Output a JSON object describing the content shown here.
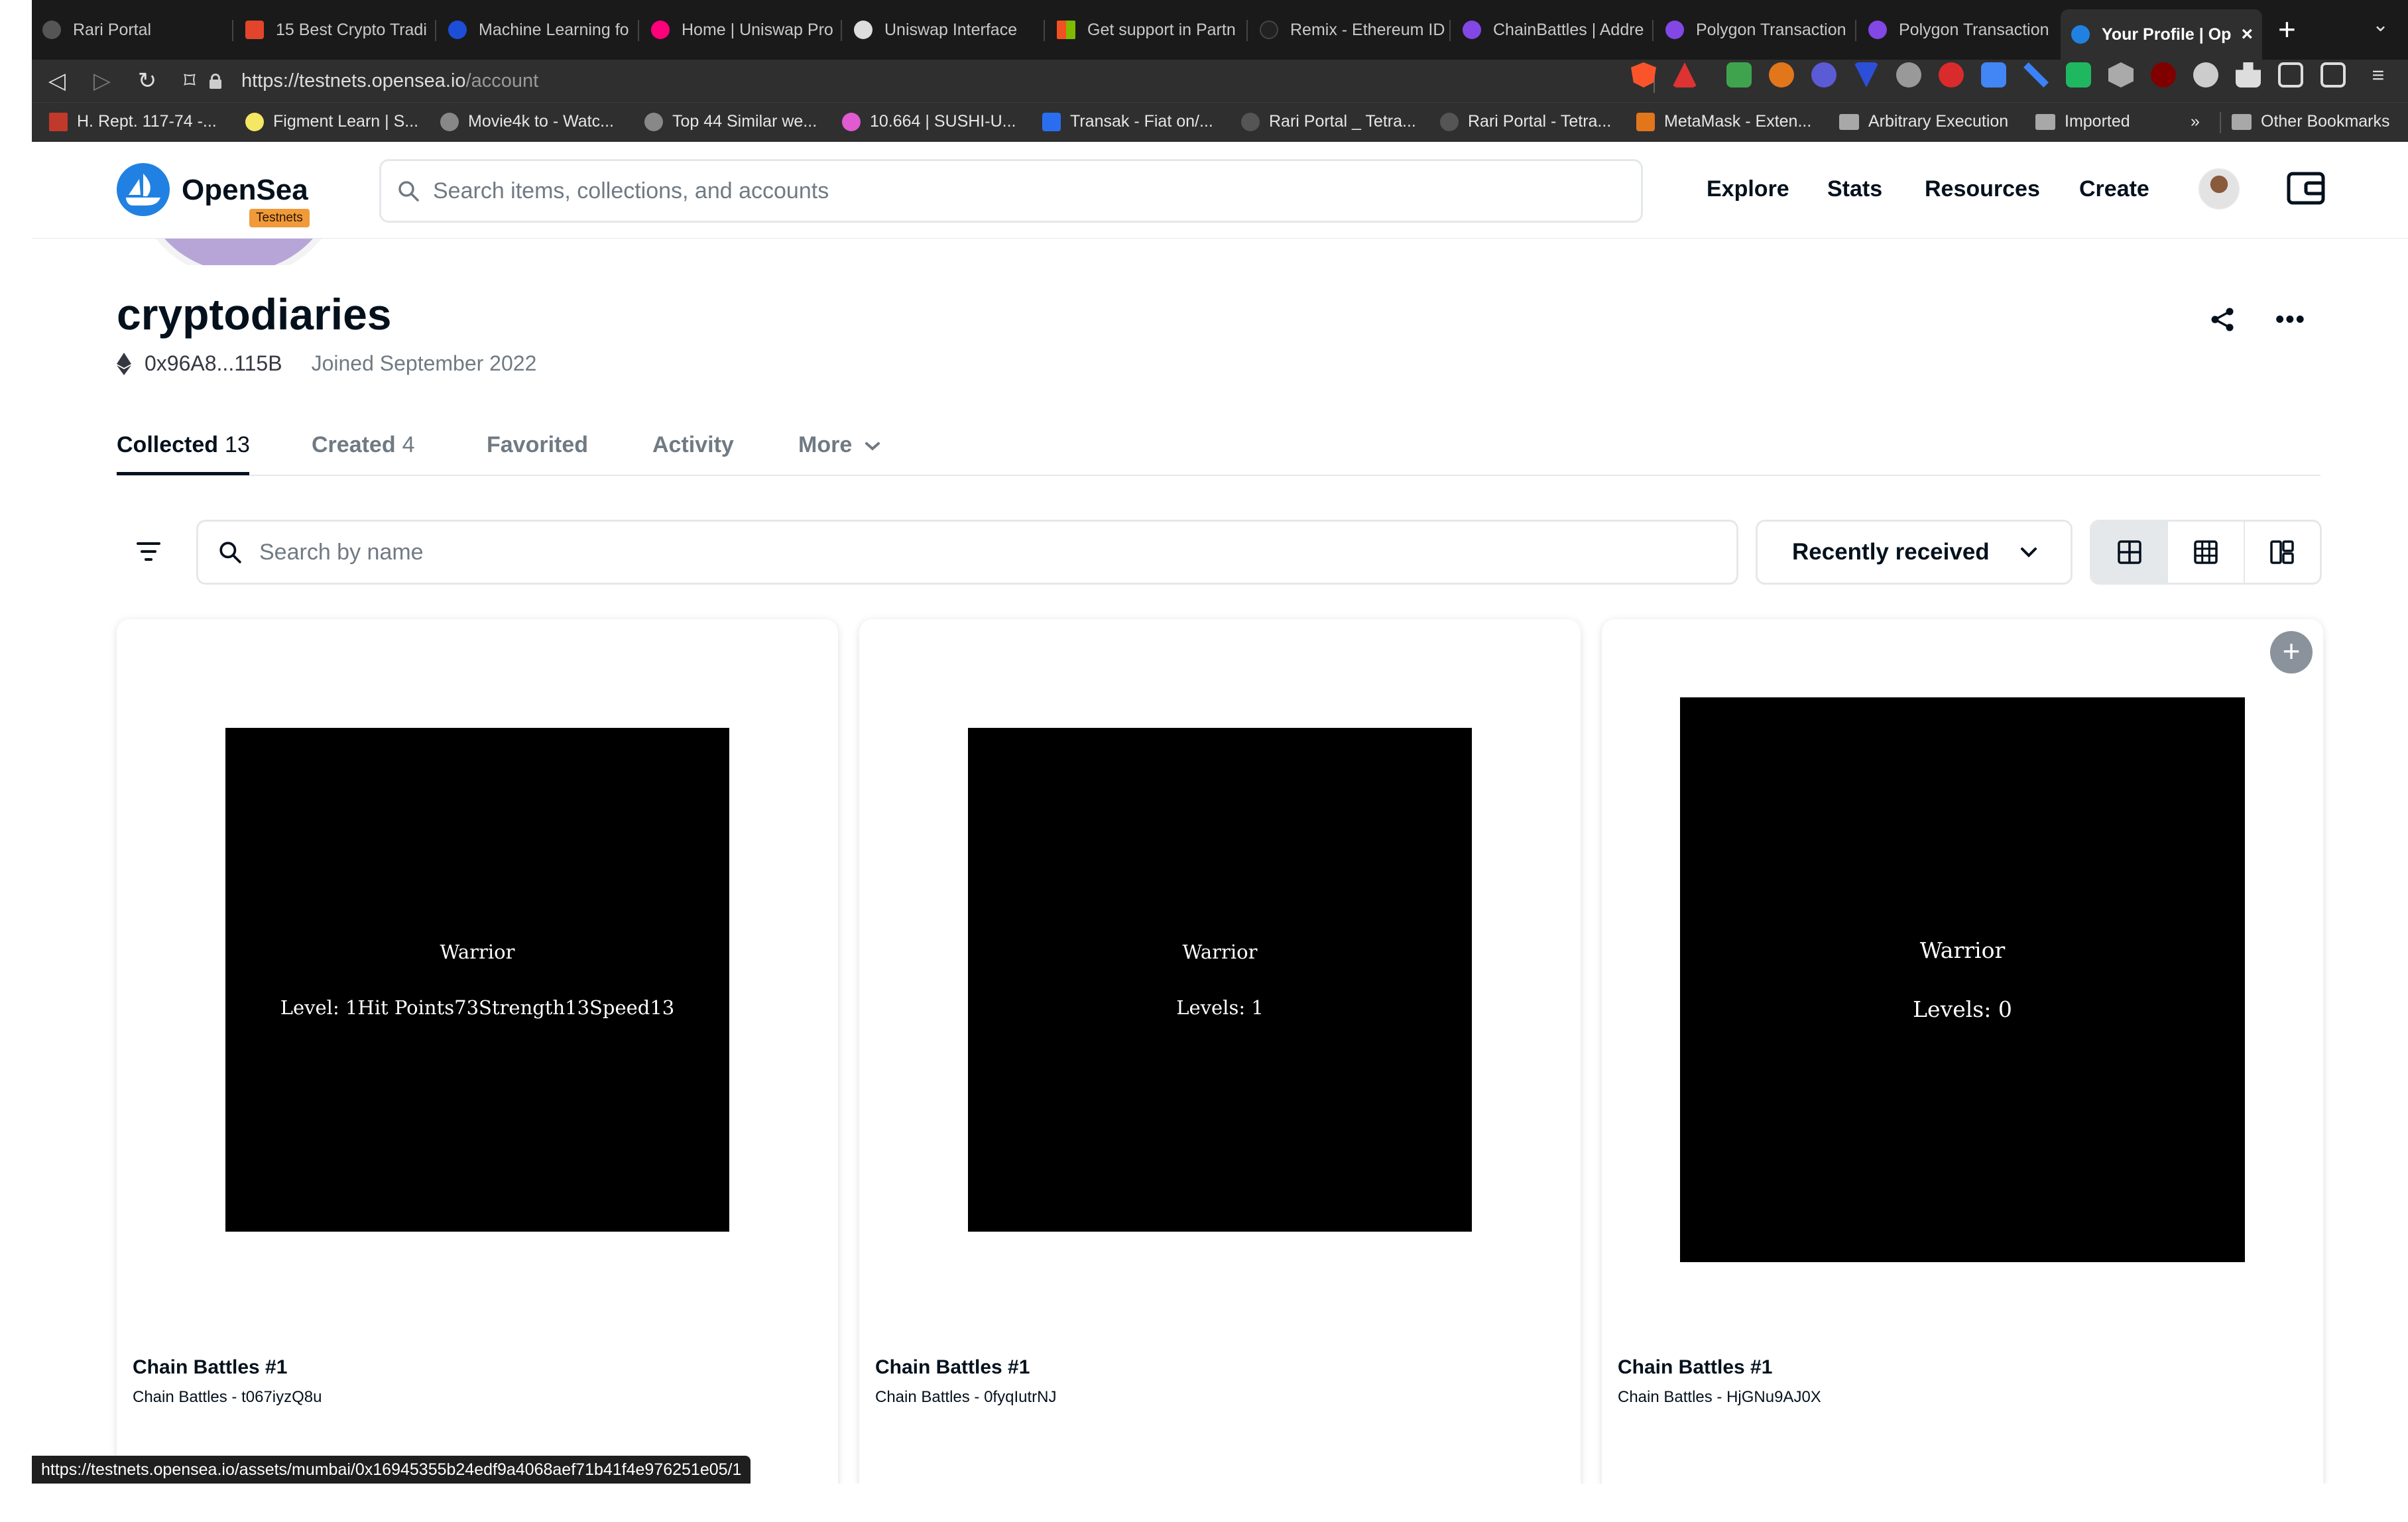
{
  "browser": {
    "tabs": [
      {
        "label": "Rari Portal",
        "color": "#555555"
      },
      {
        "label": "15 Best Crypto Tradi",
        "color": "#e2452b"
      },
      {
        "label": "Machine Learning fo",
        "color": "#1d4ed8"
      },
      {
        "label": "Home | Uniswap Pro",
        "color": "#ff007a"
      },
      {
        "label": "Uniswap Interface",
        "color": "#dddddd"
      },
      {
        "label": "Get support in Partn",
        "color": "#f25022"
      },
      {
        "label": "Remix - Ethereum ID",
        "color": "#222222"
      },
      {
        "label": "ChainBattles | Addre",
        "color": "#8247e5"
      },
      {
        "label": "Polygon Transaction",
        "color": "#8247e5"
      },
      {
        "label": "Polygon Transaction",
        "color": "#8247e5"
      },
      {
        "label": "Your Profile | Op",
        "color": "#2081e2"
      }
    ],
    "url": {
      "domain": "https://testnets.opensea.io",
      "path": "/account"
    },
    "bookmarks": [
      {
        "label": "H. Rept. 117-74 -...",
        "color": "#c0392b"
      },
      {
        "label": "Figment Learn | S...",
        "color": "#f5e663"
      },
      {
        "label": "Movie4k to - Watc...",
        "color": "#888888"
      },
      {
        "label": "Top 44 Similar we...",
        "color": "#888888"
      },
      {
        "label": "10.664 | SUSHI-U...",
        "color": "#e05ad1"
      },
      {
        "label": "Transak - Fiat on/...",
        "color": "#2a6ef0"
      },
      {
        "label": "Rari Portal _ Tetra...",
        "color": "#555555"
      },
      {
        "label": "Rari Portal - Tetra...",
        "color": "#555555"
      },
      {
        "label": "MetaMask - Exten...",
        "color": "#e2761b"
      },
      {
        "label": "Arbitrary Execution",
        "color": "folder"
      },
      {
        "label": "Imported",
        "color": "folder"
      }
    ],
    "bookmarks_overflow": "»",
    "other_bookmarks": "Other Bookmarks",
    "status_url": "https://testnets.opensea.io/assets/mumbai/0x16945355b24edf9a4068aef71b41f4e976251e05/1"
  },
  "header": {
    "brand": "OpenSea",
    "badge": "Testnets",
    "search_placeholder": "Search items, collections, and accounts",
    "nav": [
      "Explore",
      "Stats",
      "Resources",
      "Create"
    ]
  },
  "profile": {
    "username": "cryptodiaries",
    "address": "0x96A8...115B",
    "joined": "Joined September 2022"
  },
  "tabs": [
    {
      "label": "Collected",
      "count": "13"
    },
    {
      "label": "Created",
      "count": "4"
    },
    {
      "label": "Favorited",
      "count": ""
    },
    {
      "label": "Activity",
      "count": ""
    },
    {
      "label": "More",
      "count": ""
    }
  ],
  "filters": {
    "search_placeholder": "Search by name",
    "sort_value": "Recently received"
  },
  "items": [
    {
      "image_title": "Warrior",
      "image_stats": "Level: 1Hit Points73Strength13Speed13",
      "name": "Chain Battles #1",
      "collection": "Chain Battles - t067iyzQ8u"
    },
    {
      "image_title": "Warrior",
      "image_stats": "Levels: 1",
      "name": "Chain Battles #1",
      "collection": "Chain Battles - 0fyqIutrNJ"
    },
    {
      "image_title": "Warrior",
      "image_stats": "Levels: 0",
      "name": "Chain Battles #1",
      "collection": "Chain Battles - HjGNu9AJ0X"
    }
  ],
  "colors": {
    "brand_blue": "#2081e2",
    "text": "#04111d",
    "muted": "#707a83",
    "border": "#e5e8eb",
    "testnet_badge": "#f09a3a"
  }
}
